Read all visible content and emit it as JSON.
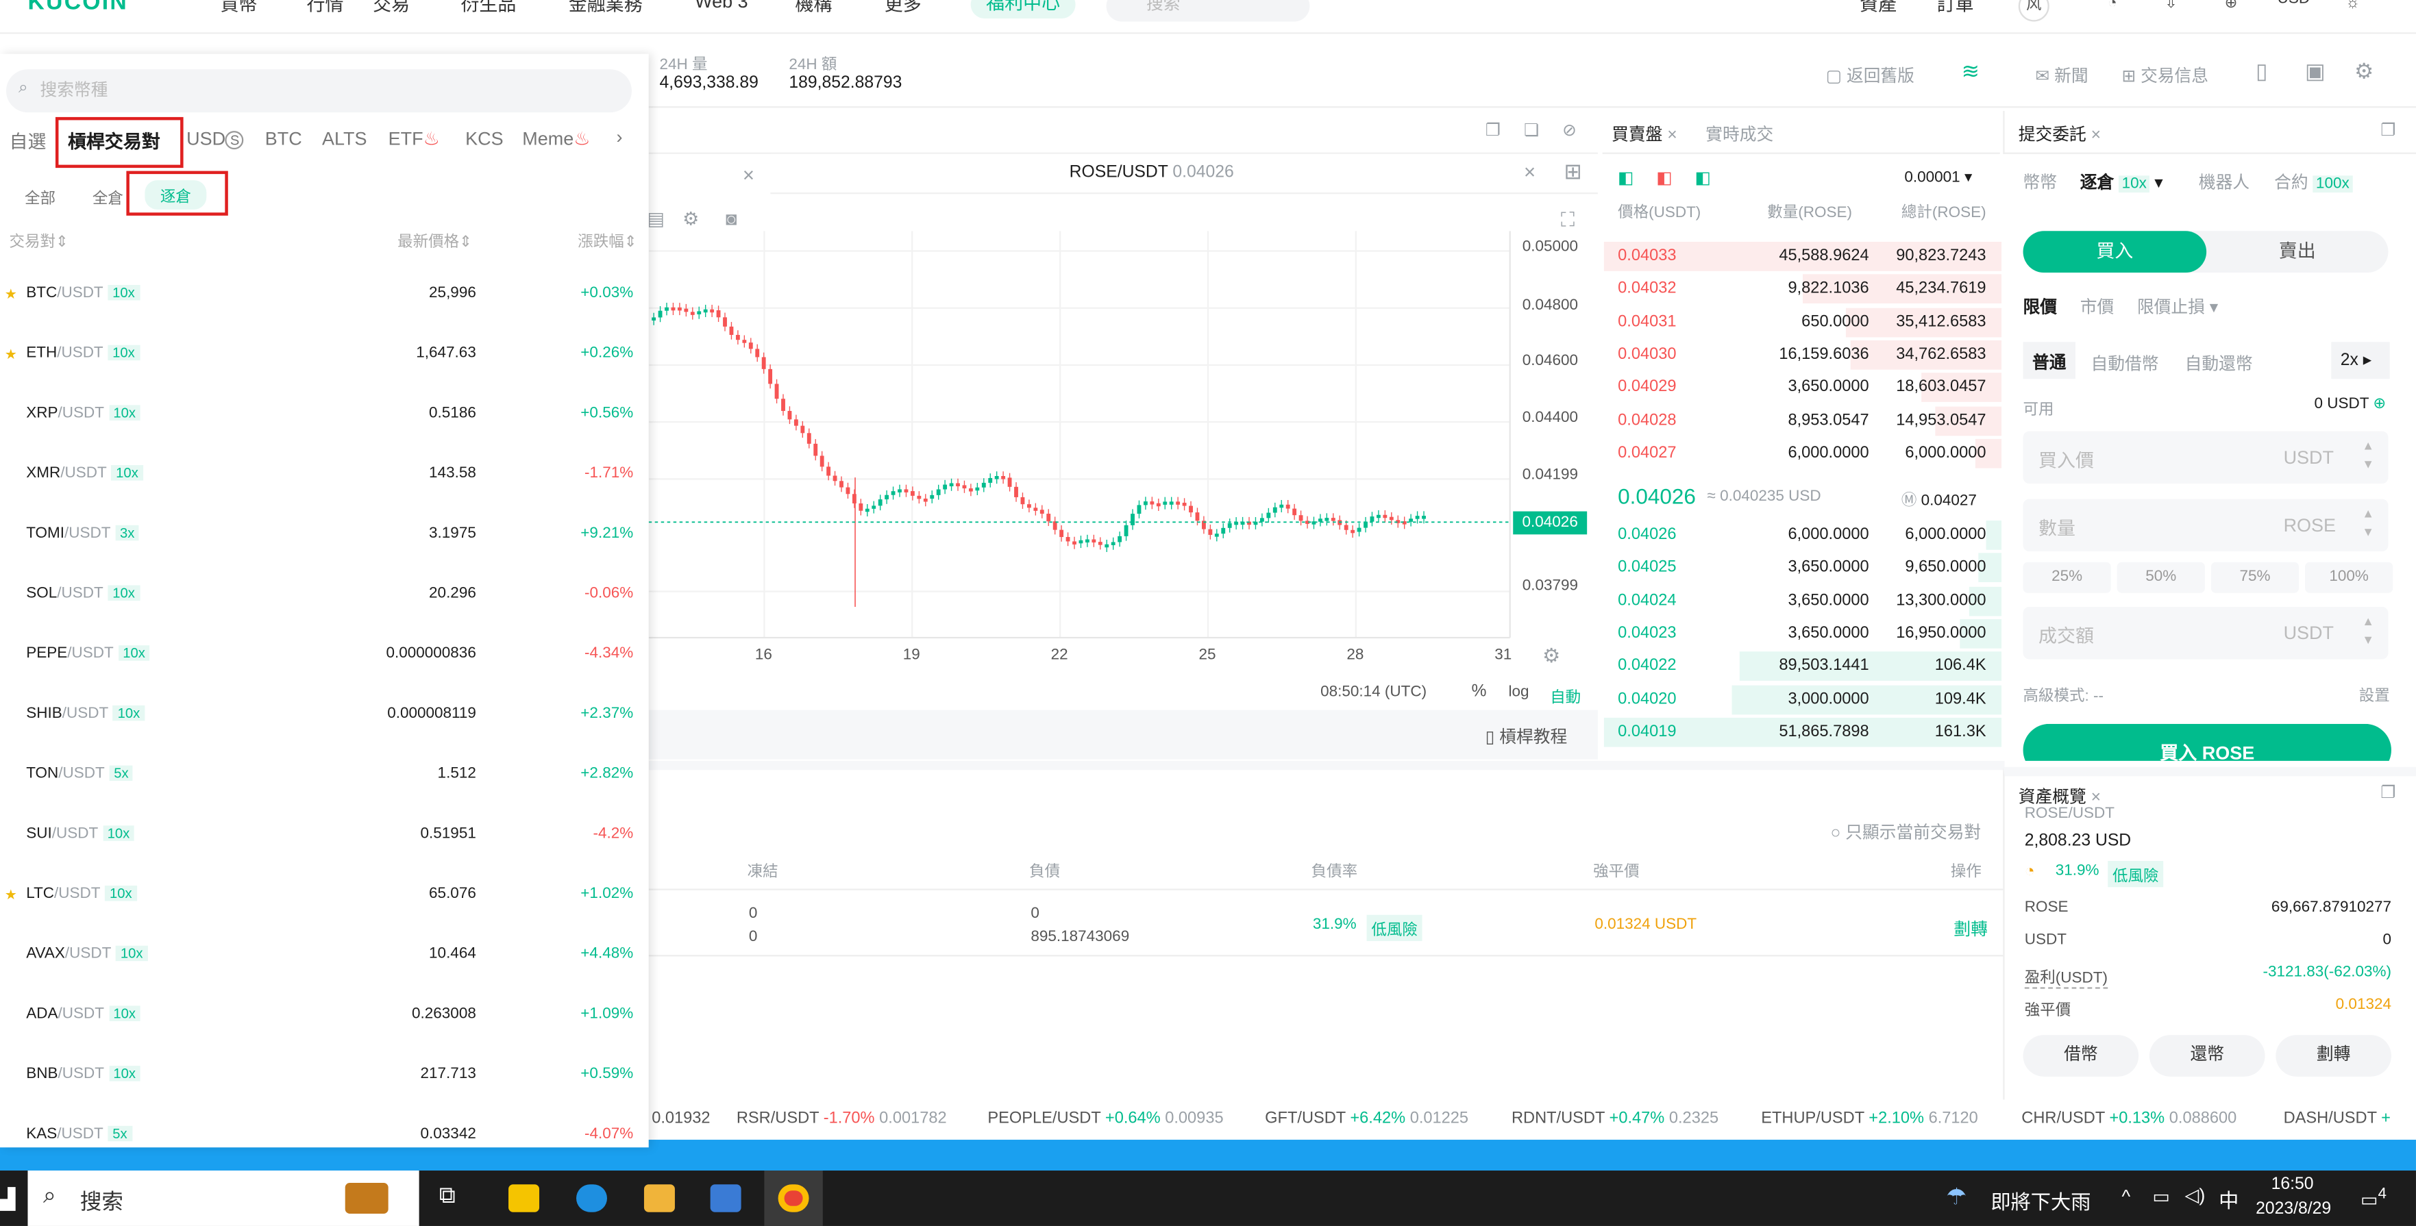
{
  "topnav": {
    "logo": "KUCOIN",
    "items": [
      "買幣",
      "行情",
      "交易",
      "衍生品",
      "金融業務",
      "Web 3",
      "機構",
      "更多"
    ],
    "promo": "福利中心",
    "search_placeholder": "搜索",
    "right": [
      "資產",
      "訂單",
      "风"
    ],
    "currency": "USD"
  },
  "stats": {
    "vol_label": "24H 量",
    "vol": "4,693,338.89",
    "amt_label": "24H 額",
    "amt": "189,852.88793"
  },
  "toolbar": {
    "back": "返回舊版",
    "news": "新聞",
    "info": "交易信息"
  },
  "left": {
    "search": "搜索幣種",
    "tabs": [
      "自選",
      "槓桿交易對",
      "USD",
      "BTC",
      "ALTS",
      "ETF",
      "KCS",
      "Meme"
    ],
    "usd_suffix": "S",
    "subtabs": [
      "全部",
      "全倉",
      "逐倉"
    ],
    "headers": [
      "交易對",
      "最新價格",
      "漲跌幅"
    ],
    "rows": [
      {
        "base": "BTC",
        "quote": "/USDT",
        "lev": "10x",
        "price": "25,996",
        "chg": "+0.03%",
        "up": true,
        "star": true
      },
      {
        "base": "ETH",
        "quote": "/USDT",
        "lev": "10x",
        "price": "1,647.63",
        "chg": "+0.26%",
        "up": true,
        "star": true
      },
      {
        "base": "XRP",
        "quote": "/USDT",
        "lev": "10x",
        "price": "0.5186",
        "chg": "+0.56%",
        "up": true,
        "star": false
      },
      {
        "base": "XMR",
        "quote": "/USDT",
        "lev": "10x",
        "price": "143.58",
        "chg": "-1.71%",
        "up": false,
        "star": false
      },
      {
        "base": "TOMI",
        "quote": "/USDT",
        "lev": "3x",
        "price": "3.1975",
        "chg": "+9.21%",
        "up": true,
        "star": false
      },
      {
        "base": "SOL",
        "quote": "/USDT",
        "lev": "10x",
        "price": "20.296",
        "chg": "-0.06%",
        "up": false,
        "star": false
      },
      {
        "base": "PEPE",
        "quote": "/USDT",
        "lev": "10x",
        "price": "0.000000836",
        "chg": "-4.34%",
        "up": false,
        "star": false
      },
      {
        "base": "SHIB",
        "quote": "/USDT",
        "lev": "10x",
        "price": "0.000008119",
        "chg": "+2.37%",
        "up": true,
        "star": false
      },
      {
        "base": "TON",
        "quote": "/USDT",
        "lev": "5x",
        "price": "1.512",
        "chg": "+2.82%",
        "up": true,
        "star": false
      },
      {
        "base": "SUI",
        "quote": "/USDT",
        "lev": "10x",
        "price": "0.51951",
        "chg": "-4.2%",
        "up": false,
        "star": false
      },
      {
        "base": "LTC",
        "quote": "/USDT",
        "lev": "10x",
        "price": "65.076",
        "chg": "+1.02%",
        "up": true,
        "star": true
      },
      {
        "base": "AVAX",
        "quote": "/USDT",
        "lev": "10x",
        "price": "10.464",
        "chg": "+4.48%",
        "up": true,
        "star": false
      },
      {
        "base": "ADA",
        "quote": "/USDT",
        "lev": "10x",
        "price": "0.263008",
        "chg": "+1.09%",
        "up": true,
        "star": false
      },
      {
        "base": "BNB",
        "quote": "/USDT",
        "lev": "10x",
        "price": "217.713",
        "chg": "+0.59%",
        "up": true,
        "star": false
      },
      {
        "base": "KAS",
        "quote": "/USDT",
        "lev": "5x",
        "price": "0.03342",
        "chg": "-4.07%",
        "up": false,
        "star": false
      }
    ]
  },
  "chart": {
    "pair": "ROSE/USDT",
    "price": "0.04026",
    "yticks": [
      "0.05000",
      "0.04800",
      "0.04600",
      "0.04400",
      "0.04199",
      "0.03799"
    ],
    "current": "0.04026",
    "xticks": [
      "16",
      "19",
      "22",
      "25",
      "28",
      "31"
    ],
    "time": "08:50:14 (UTC)",
    "pct": "%",
    "log": "log",
    "auto": "自動",
    "tutorial": "槓桿教程"
  },
  "positions": {
    "only_current": "只顯示當前交易對",
    "cols": [
      "凍結",
      "負債",
      "負債率",
      "強平價",
      "操作"
    ],
    "frozen": [
      "0",
      "0"
    ],
    "debt": [
      "0",
      "895.18743069"
    ],
    "ratio": "31.9%",
    "risk": "低風險",
    "liq": "0.01324 USDT",
    "action": "劃轉"
  },
  "orderbook": {
    "tabs": [
      "買賣盤",
      "實時成交"
    ],
    "precision": "0.00001",
    "headers": [
      "價格(USDT)",
      "數量(ROSE)",
      "總計(ROSE)"
    ],
    "asks": [
      [
        "0.04033",
        "45,588.9624",
        "90,823.7243",
        1.0
      ],
      [
        "0.04032",
        "9,822.1036",
        "45,234.7619",
        0.5
      ],
      [
        "0.04031",
        "650.0000",
        "35,412.6583",
        0.39
      ],
      [
        "0.04030",
        "16,159.6036",
        "34,762.6583",
        0.38
      ],
      [
        "0.04029",
        "3,650.0000",
        "18,603.0457",
        0.2
      ],
      [
        "0.04028",
        "8,953.0547",
        "14,953.0547",
        0.165
      ],
      [
        "0.04027",
        "6,000.0000",
        "6,000.0000",
        0.066
      ]
    ],
    "mid": "0.04026",
    "mid_usd": "≈ 0.040235 USD",
    "mark": "0.04027",
    "bids": [
      [
        "0.04026",
        "6,000.0000",
        "6,000.0000",
        0.037
      ],
      [
        "0.04025",
        "3,650.0000",
        "9,650.0000",
        0.06
      ],
      [
        "0.04024",
        "3,650.0000",
        "13,300.0000",
        0.082
      ],
      [
        "0.04023",
        "3,650.0000",
        "16,950.0000",
        0.105
      ],
      [
        "0.04022",
        "89,503.1441",
        "106.4K",
        0.66
      ],
      [
        "0.04020",
        "3,000.0000",
        "109.4K",
        0.68
      ],
      [
        "0.04019",
        "51,865.7898",
        "161.3K",
        1.0
      ]
    ]
  },
  "form": {
    "title": "提交委託",
    "modes": [
      "幣幣",
      "逐倉",
      "機器人",
      "合約"
    ],
    "iso_lev": "10x",
    "fut_lev": "100x",
    "buy": "買入",
    "sell": "賣出",
    "types": [
      "限價",
      "市價",
      "限價止損"
    ],
    "sub": [
      "普通",
      "自動借幣",
      "自動還幣"
    ],
    "lev": "2x",
    "avail_label": "可用",
    "avail": "0 USDT",
    "price_ph": "買入價",
    "qty_ph": "數量",
    "total_ph": "成交額",
    "usdt": "USDT",
    "rose": "ROSE",
    "pcts": [
      "25%",
      "50%",
      "75%",
      "100%"
    ],
    "adv_label": "高級模式: --",
    "settings": "設置",
    "submit": "買入 ROSE"
  },
  "assets": {
    "title": "資產概覽",
    "pair": "ROSE/USDT",
    "total": "2,808.23 USD",
    "ratio": "31.9%",
    "risk": "低風險",
    "rows": [
      [
        "ROSE",
        "69,667.87910277"
      ],
      [
        "USDT",
        "0"
      ],
      [
        "盈利(USDT)",
        "-3121.83(-62.03%)"
      ],
      [
        "強平價",
        "0.01324"
      ]
    ],
    "buttons": [
      "借幣",
      "還幣",
      "劃轉"
    ]
  },
  "ticker": [
    [
      "0.01932",
      "",
      ""
    ],
    [
      "RSR/USDT",
      "-1.70%",
      "0.001782"
    ],
    [
      "PEOPLE/USDT",
      "+0.64%",
      "0.00935"
    ],
    [
      "GFT/USDT",
      "+6.42%",
      "0.01225"
    ],
    [
      "RDNT/USDT",
      "+0.47%",
      "0.2325"
    ],
    [
      "ETHUP/USDT",
      "+2.10%",
      "6.7120"
    ],
    [
      "CHR/USDT",
      "+0.13%",
      "0.088600"
    ],
    [
      "DASH/USDT",
      "+",
      ""
    ]
  ],
  "taskbar": {
    "search": "搜索",
    "weather": "即將下大雨",
    "ime": "中",
    "time": "16:50",
    "date": "2023/8/29",
    "notif": "4"
  },
  "colors": {
    "green": "#01bc8d",
    "red": "#f65454"
  }
}
